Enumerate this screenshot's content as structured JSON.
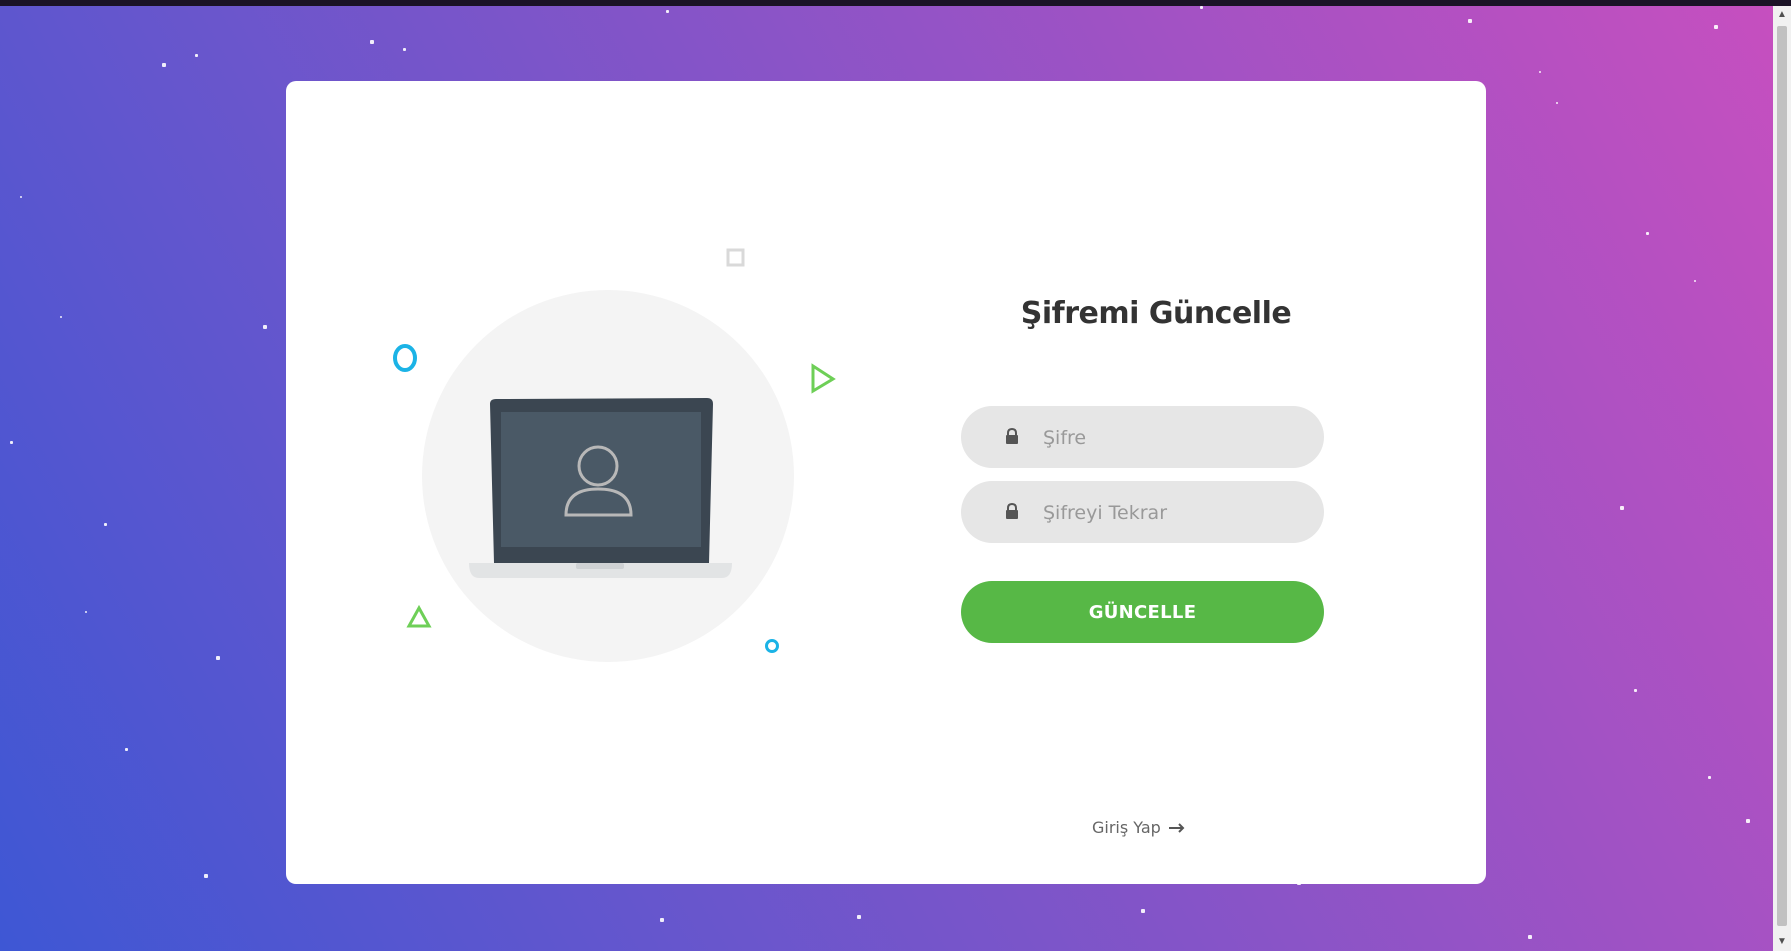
{
  "form": {
    "title": "Şifremi Güncelle",
    "password_placeholder": "Şifre",
    "password_repeat_placeholder": "Şifreyi Tekrar",
    "submit_label": "GÜNCELLE"
  },
  "footer": {
    "login_link_label": "Giriş Yap",
    "login_link_icon": "arrow-right-icon"
  },
  "icons": {
    "field_icon": "lock-icon",
    "illustration": "laptop-user-illustration"
  },
  "colors": {
    "background_gradient": [
      "#3e57d4",
      "#7b55c9",
      "#c64fbf"
    ],
    "button": "#57b846",
    "input_bg": "#e6e6e6",
    "title": "#333333",
    "accent_blue": "#1bb3e6",
    "accent_green": "#6ecf57"
  }
}
